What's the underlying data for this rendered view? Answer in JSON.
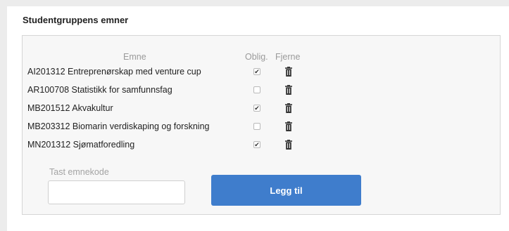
{
  "section": {
    "title": "Studentgruppens emner"
  },
  "table": {
    "headers": {
      "emne": "Emne",
      "oblig": "Oblig.",
      "fjerne": "Fjerne"
    },
    "rows": [
      {
        "course": "AI201312 Entreprenørskap med venture cup",
        "oblig": true
      },
      {
        "course": "AR100708 Statistikk for samfunnsfag",
        "oblig": false
      },
      {
        "course": "MB201512 Akvakultur",
        "oblig": true
      },
      {
        "course": "MB203312 Biomarin verdiskaping og forskning",
        "oblig": false
      },
      {
        "course": "MN201312 Sjømatforedling",
        "oblig": true
      }
    ],
    "check_mark": "✔",
    "remove_icon": "trash-icon"
  },
  "add_form": {
    "label": "Tast emnekode",
    "input_value": "",
    "button_label": "Legg til"
  },
  "colors": {
    "button": "#3f7dcc",
    "panel_bg": "#f7f7f7",
    "page_bg": "#ececec"
  }
}
